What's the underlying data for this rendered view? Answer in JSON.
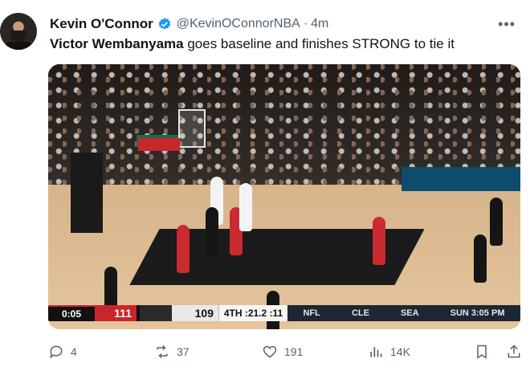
{
  "author": {
    "name": "Kevin O'Connor",
    "handle": "@KevinOConnorNBA",
    "separator": "·",
    "time": "4m"
  },
  "tweet": {
    "bold": "Victor Wembanyama",
    "rest": " goes baseline and finishes STRONG to tie it"
  },
  "scorebug": {
    "clock": "0:05",
    "home_score": "111",
    "away_score": "109",
    "period": "4TH :21.2 :11",
    "ticker": [
      "NFL",
      "CLE",
      "SEA",
      "SUN 3:05 PM"
    ]
  },
  "actions": {
    "replies": "4",
    "reposts": "37",
    "likes": "191",
    "views": "14K"
  },
  "colors": {
    "verified": "#1d9bf0",
    "secondary_text": "#536471",
    "rockets_red": "#c8262b"
  }
}
